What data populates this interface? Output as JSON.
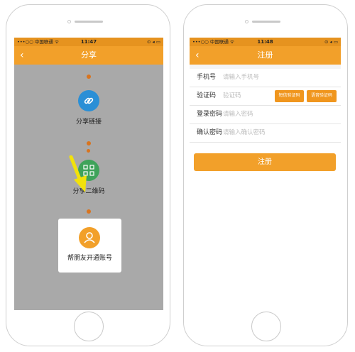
{
  "left_screen": {
    "status": {
      "carrier": "•••○○ 中国联通 ᯤ",
      "time": "11:47",
      "battery": "⊙ ◂ ▭"
    },
    "nav": {
      "back_icon": "‹",
      "title": "分享"
    },
    "items": [
      {
        "label": "分享链接",
        "icon": "link-icon",
        "color": "#2a8fd6"
      },
      {
        "label": "分享二维码",
        "icon": "qrcode-icon",
        "color": "#3fa35a"
      },
      {
        "label": "帮朋友开通账号",
        "icon": "person-icon",
        "color": "#f2a02a"
      }
    ],
    "overlay_color": "#a9a9a9",
    "accent_color": "#f2a02a"
  },
  "right_screen": {
    "status": {
      "carrier": "•••○○ 中国联通 ᯤ",
      "time": "11:48",
      "battery": "⊙ ◂ ▭"
    },
    "nav": {
      "back_icon": "‹",
      "title": "注册"
    },
    "fields": [
      {
        "label": "手机号",
        "placeholder": "请输入手机号"
      },
      {
        "label": "验证码",
        "placeholder": "验证码"
      },
      {
        "label": "登录密码",
        "placeholder": "请输入密码"
      },
      {
        "label": "确认密码",
        "placeholder": "请输入确认密码"
      }
    ],
    "sms_code_button": "短信验证码",
    "voice_code_button": "语音验证码",
    "register_button": "注册",
    "accent_color": "#f2a02a"
  },
  "annotation": {
    "arrow_color": "#f2e20b"
  }
}
